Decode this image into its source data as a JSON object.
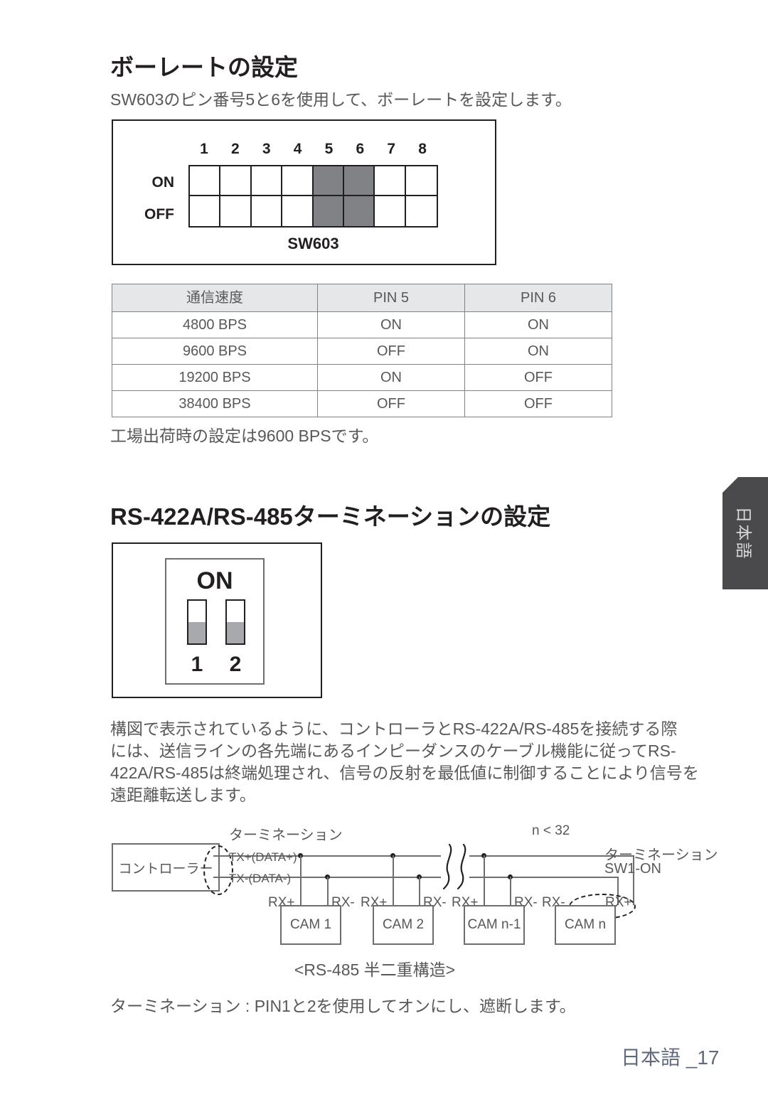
{
  "page": {
    "footer_text": "日本語 _17",
    "side_tab_label": "日本語"
  },
  "section_baud": {
    "heading": "ボーレートの設定",
    "intro": "SW603のピン番号5と6を使用して、ボーレートを設定します。",
    "dip": {
      "caption": "SW603",
      "row_on_label": "ON",
      "row_off_label": "OFF",
      "pins": [
        "1",
        "2",
        "3",
        "4",
        "5",
        "6",
        "7",
        "8"
      ],
      "highlighted_pins": [
        "5",
        "6"
      ],
      "highlight_color": "#808285"
    },
    "table": {
      "headers": [
        "通信速度",
        "PIN 5",
        "PIN 6"
      ],
      "rows": [
        [
          "4800 BPS",
          "ON",
          "ON"
        ],
        [
          "9600 BPS",
          "OFF",
          "ON"
        ],
        [
          "19200 BPS",
          "ON",
          "OFF"
        ],
        [
          "38400 BPS",
          "OFF",
          "OFF"
        ]
      ]
    },
    "note": "工場出荷時の設定は9600 BPSです。"
  },
  "section_termination": {
    "heading": "RS-422A/RS-485ターミネーションの設定",
    "switch": {
      "on_label": "ON",
      "pins": [
        "1",
        "2"
      ]
    },
    "body_lines": [
      "構図で表示されているように、コントローラとRS-422A/RS-485を接続する際",
      "には、送信ラインの各先端にあるインピーダンスのケーブル機能に従ってRS-",
      "422A/RS-485は終端処理され、信号の反射を最低値に制御することにより信号を",
      "遠距離転送します。"
    ],
    "diagram": {
      "controller_label": "コントローラー",
      "termination_label_left": "ターミネーション",
      "tx_plus_label": "TX+(DATA+)",
      "tx_minus_label": "TX-(DATA-)",
      "limit_label": "n < 32",
      "termination_label_right": "ターミネーション",
      "termination_sw_right": "SW1-ON",
      "nodes": [
        {
          "name": "CAM 1",
          "left_pin": "RX+",
          "right_pin": "RX-"
        },
        {
          "name": "CAM 2",
          "left_pin": "RX+",
          "right_pin": "RX-"
        },
        {
          "name": "CAM n-1",
          "left_pin": "RX+",
          "right_pin": "RX-"
        },
        {
          "name": "CAM n",
          "left_pin": "RX-",
          "right_pin": "RX+"
        }
      ]
    },
    "diagram_caption": "<RS-485 半二重構造>",
    "footnote": "ターミネーション : PIN1と2を使用してオンにし、遮断します。"
  }
}
